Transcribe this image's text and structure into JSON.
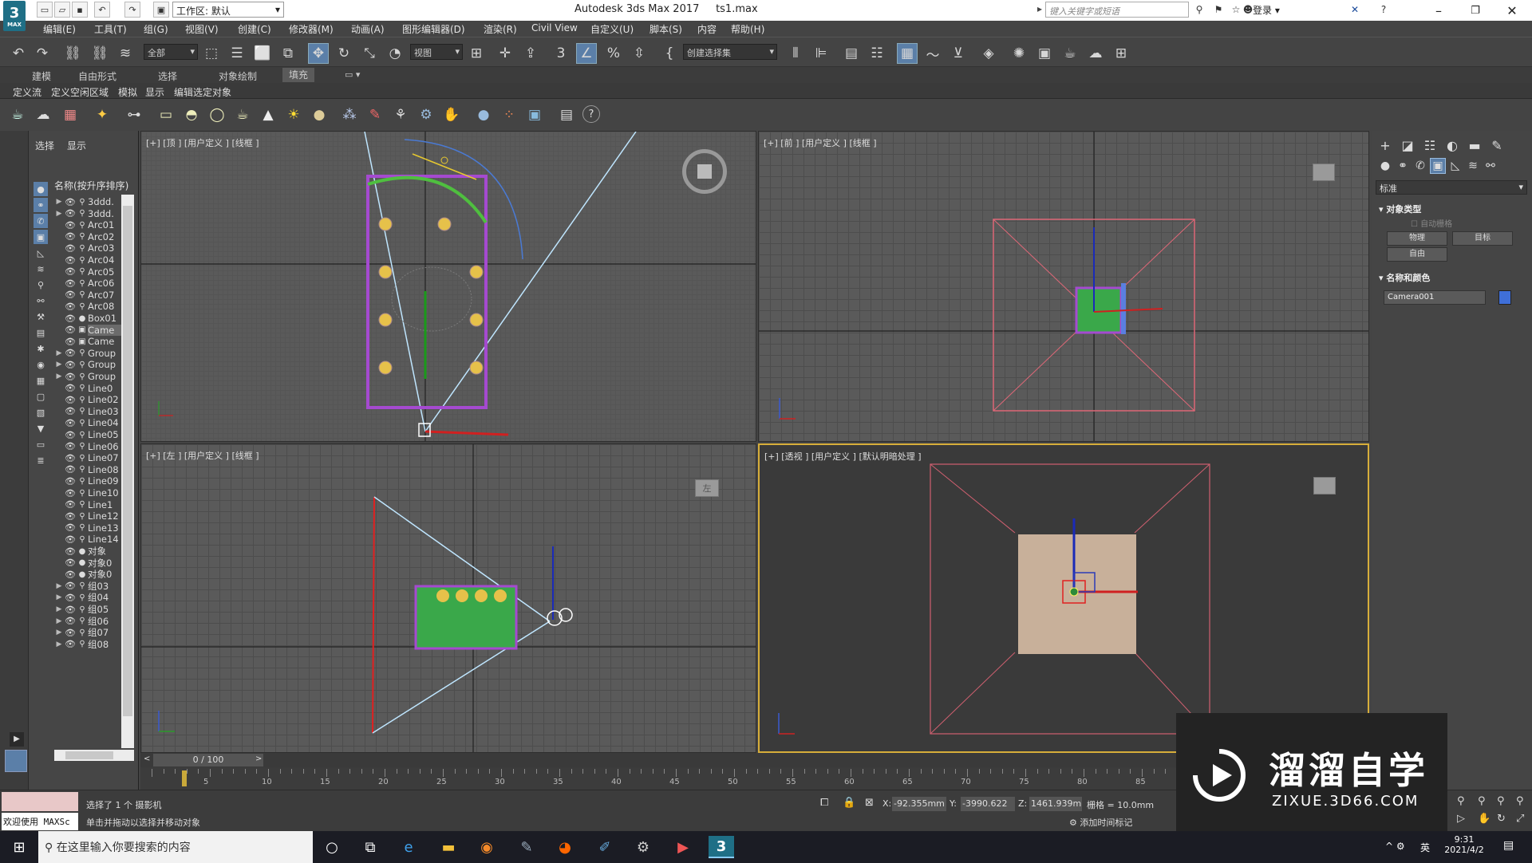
{
  "app": {
    "logo_label": "3",
    "logo_sub": "MAX",
    "workspace": "工作区: 默认",
    "title": "Autodesk 3ds Max 2017",
    "file": "ts1.max",
    "search_placeholder": "键入关键字或短语",
    "login": "登录"
  },
  "menu": [
    "编辑(E)",
    "工具(T)",
    "组(G)",
    "视图(V)",
    "创建(C)",
    "修改器(M)",
    "动画(A)",
    "图形编辑器(D)",
    "渲染(R)",
    "Civil View",
    "自定义(U)",
    "脚本(S)",
    "内容",
    "帮助(H)"
  ],
  "toolbar": {
    "selection_filter": "全部",
    "ref_coord": "视图",
    "named_selection": "创建选择集"
  },
  "ribbon": {
    "tabs": [
      "建模",
      "自由形式",
      "选择",
      "对象绘制",
      "填充"
    ],
    "active_tab": "填充",
    "subtabs": [
      "定义流",
      "定义空闲区域",
      "模拟",
      "显示",
      "编辑选定对象"
    ]
  },
  "scene_explorer": {
    "tabs": [
      "选择",
      "显示"
    ],
    "header": "名称(按升序排序)",
    "rows": [
      {
        "name": "3ddd.",
        "exp": "▶",
        "type": "grp"
      },
      {
        "name": "3ddd.",
        "exp": "▶",
        "type": "grp"
      },
      {
        "name": "Arc01",
        "exp": "",
        "type": "shape"
      },
      {
        "name": "Arc02",
        "exp": "",
        "type": "shape"
      },
      {
        "name": "Arc03",
        "exp": "",
        "type": "shape"
      },
      {
        "name": "Arc04",
        "exp": "",
        "type": "shape"
      },
      {
        "name": "Arc05",
        "exp": "",
        "type": "shape"
      },
      {
        "name": "Arc06",
        "exp": "",
        "type": "shape"
      },
      {
        "name": "Arc07",
        "exp": "",
        "type": "shape"
      },
      {
        "name": "Arc08",
        "exp": "",
        "type": "shape"
      },
      {
        "name": "Box01",
        "exp": "",
        "type": "geo"
      },
      {
        "name": "Came",
        "exp": "",
        "type": "cam",
        "selected": true
      },
      {
        "name": "Came",
        "exp": "",
        "type": "cam"
      },
      {
        "name": "Group",
        "exp": "▶",
        "type": "grp"
      },
      {
        "name": "Group",
        "exp": "▶",
        "type": "grp"
      },
      {
        "name": "Group",
        "exp": "▶",
        "type": "grp"
      },
      {
        "name": "Line0",
        "exp": "",
        "type": "shape"
      },
      {
        "name": "Line02",
        "exp": "",
        "type": "shape"
      },
      {
        "name": "Line03",
        "exp": "",
        "type": "shape"
      },
      {
        "name": "Line04",
        "exp": "",
        "type": "shape"
      },
      {
        "name": "Line05",
        "exp": "",
        "type": "shape"
      },
      {
        "name": "Line06",
        "exp": "",
        "type": "shape"
      },
      {
        "name": "Line07",
        "exp": "",
        "type": "shape"
      },
      {
        "name": "Line08",
        "exp": "",
        "type": "shape"
      },
      {
        "name": "Line09",
        "exp": "",
        "type": "shape"
      },
      {
        "name": "Line10",
        "exp": "",
        "type": "shape"
      },
      {
        "name": "Line1",
        "exp": "",
        "type": "shape"
      },
      {
        "name": "Line12",
        "exp": "",
        "type": "shape"
      },
      {
        "name": "Line13",
        "exp": "",
        "type": "shape"
      },
      {
        "name": "Line14",
        "exp": "",
        "type": "shape"
      },
      {
        "name": "对象",
        "exp": "",
        "type": "geo"
      },
      {
        "name": "对象0",
        "exp": "",
        "type": "geo"
      },
      {
        "name": "对象0",
        "exp": "",
        "type": "geo"
      },
      {
        "name": "组03",
        "exp": "▶",
        "type": "grp"
      },
      {
        "name": "组04",
        "exp": "▶",
        "type": "grp"
      },
      {
        "name": "组05",
        "exp": "▶",
        "type": "grp"
      },
      {
        "name": "组06",
        "exp": "▶",
        "type": "grp"
      },
      {
        "name": "组07",
        "exp": "▶",
        "type": "grp"
      },
      {
        "name": "组08",
        "exp": "▶",
        "type": "grp"
      }
    ]
  },
  "viewports": {
    "top": "[+] [顶 ] [用户定义 ] [线框 ]",
    "front": "[+] [前 ] [用户定义 ] [线框 ]",
    "left": "[+] [左 ] [用户定义 ] [线框 ]",
    "persp": "[+] [透视 ] [用户定义 ] [默认明暗处理 ]",
    "viewcube_left": "左"
  },
  "command_panel": {
    "dropdown": "标准",
    "object_type": "对象类型",
    "autogrid": "自动栅格",
    "btn_physical": "物理",
    "btn_target": "目标",
    "btn_free": "自由",
    "name_color": "名称和颜色",
    "object_name": "Camera001",
    "object_color": "#3f6fd8"
  },
  "timeline": {
    "frame_label": "0 / 100",
    "ticks": [
      "5",
      "10",
      "15",
      "20",
      "25",
      "30",
      "35",
      "40",
      "45",
      "50",
      "55",
      "60",
      "65",
      "70",
      "75",
      "80",
      "85"
    ]
  },
  "status": {
    "maxscript": "欢迎使用 MAXSc",
    "selected": "选择了 1 个 摄影机",
    "prompt": "单击并拖动以选择并移动对象",
    "x_label": "X:",
    "x": "-92.355mm",
    "y_label": "Y:",
    "y": "-3990.622",
    "z_label": "Z:",
    "z": "1461.939m",
    "grid": "栅格 = 10.0mm",
    "add_time_tag": "添加时间标记"
  },
  "taskbar": {
    "search": "在这里输入你要搜索的内容",
    "lang": "英",
    "time": "9:31",
    "date": "2021/4/2"
  },
  "watermark": {
    "title": "溜溜自学",
    "url": "ZIXUE.3D66.COM"
  }
}
